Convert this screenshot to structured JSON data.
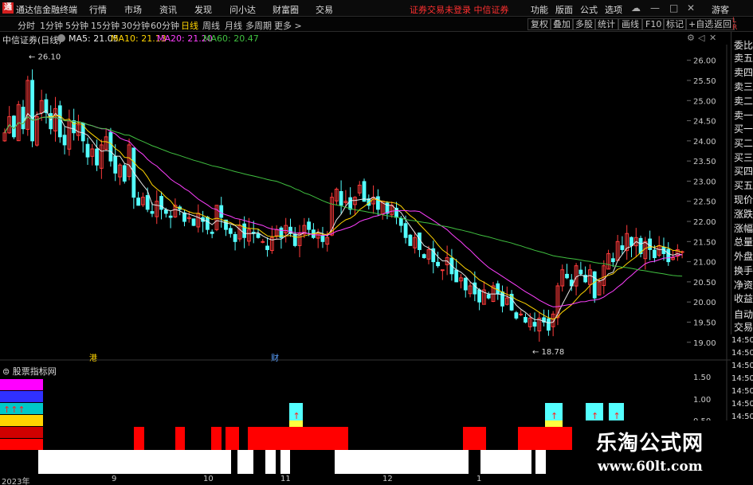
{
  "app": {
    "logo": "通",
    "title": "通达信金融终端",
    "status": "证券交易未登录 中信证券",
    "guest": "游客"
  },
  "menu": [
    "行情",
    "市场",
    "资讯",
    "发现",
    "问小达",
    "财富圈",
    "交易"
  ],
  "right_menu": [
    "功能",
    "版面",
    "公式",
    "选项"
  ],
  "window_controls": [
    "cloud-icon",
    "minimize-icon",
    "maximize-icon",
    "close-icon"
  ],
  "periods": [
    "分时",
    "1分钟",
    "5分钟",
    "15分钟",
    "30分钟",
    "60分钟",
    "日线",
    "周线",
    "月线",
    "多周期",
    "更多 >"
  ],
  "active_period": "日线",
  "tools": [
    "复权",
    "叠加",
    "多股",
    "统计",
    "画线",
    "F10",
    "标记",
    "+自选",
    "返回"
  ],
  "stock": {
    "name": "中信证券(日线)"
  },
  "ma": [
    {
      "label": "MA5: 21.05",
      "color": "#e8e8e8"
    },
    {
      "label": "MA10: 21.13",
      "color": "#ffd400"
    },
    {
      "label": "MA20: 21.20",
      "color": "#ff40ff"
    },
    {
      "label": "MA60: 20.47",
      "color": "#40c040"
    }
  ],
  "side_panel": [
    "委比",
    "卖五",
    "卖四",
    "卖三",
    "卖二",
    "卖一",
    "买一",
    "买二",
    "买三",
    "买四",
    "买五",
    "现价",
    "涨跌",
    "涨幅",
    "总量",
    "外盘",
    "换手",
    "净资",
    "收益",
    "自动",
    "交易"
  ],
  "side_top": "L\nR",
  "side_times": [
    "14:50",
    "14:50",
    "14:50",
    "14:50",
    "14:50",
    "14:50",
    "14:50"
  ],
  "price_axis": [
    "26.00",
    "25.50",
    "25.00",
    "24.50",
    "24.00",
    "23.50",
    "23.00",
    "22.50",
    "22.00",
    "21.50",
    "21.00",
    "20.50",
    "20.00",
    "19.50",
    "19.00"
  ],
  "annotations": {
    "high": "26.10",
    "low": "18.78",
    "marker1": "港",
    "marker2": "财"
  },
  "sub_panel": {
    "title": "股票指标网",
    "axis": [
      "1.50",
      "1.00",
      "0.50"
    ]
  },
  "date_axis": [
    "2023年",
    "9",
    "10",
    "11",
    "12",
    "1"
  ],
  "watermark": {
    "title": "乐淘公式网",
    "url": "www.60lt.com"
  },
  "colors": {
    "up": "#ff3b3b",
    "down": "#54ffff",
    "ma5": "#e8e8e8",
    "ma10": "#ffd400",
    "ma20": "#ff40ff",
    "ma60": "#40c040",
    "red_bar": "#ff0000",
    "white_bar": "#ffffff"
  },
  "chart_data": {
    "type": "candlestick",
    "ylim": [
      18.6,
      26.35
    ],
    "high_label": "26.10",
    "low_label": "18.78",
    "closes": [
      24.2,
      24.6,
      24.1,
      24.9,
      24.3,
      25.5,
      24.0,
      24.6,
      25.0,
      24.7,
      24.3,
      24.8,
      24.1,
      23.9,
      24.5,
      24.2,
      24.4,
      24.0,
      23.6,
      23.8,
      23.4,
      23.9,
      24.1,
      23.5,
      23.2,
      23.4,
      23.0,
      23.9,
      22.6,
      22.4,
      22.6,
      22.3,
      22.2,
      22.5,
      22.3,
      22.2,
      22.1,
      22.4,
      22.3,
      22.0,
      22.1,
      21.9,
      22.2,
      22.0,
      21.8,
      21.7,
      22.4,
      22.1,
      21.8,
      21.7,
      21.5,
      21.9,
      21.6,
      21.8,
      21.7,
      21.6,
      21.5,
      21.3,
      21.6,
      21.8,
      21.6,
      21.9,
      21.7,
      21.4,
      21.7,
      21.9,
      21.8,
      21.6,
      21.7,
      21.5,
      21.6,
      22.6,
      22.8,
      22.4,
      22.5,
      22.3,
      22.6,
      22.9,
      22.5,
      22.4,
      22.6,
      22.3,
      22.5,
      22.2,
      22.4,
      22.1,
      21.9,
      21.6,
      21.4,
      21.6,
      21.3,
      21.1,
      21.3,
      21.0,
      20.9,
      20.8,
      21.1,
      20.7,
      20.5,
      20.6,
      20.3,
      20.4,
      20.2,
      20.0,
      20.3,
      20.1,
      20.4,
      20.2,
      19.9,
      20.1,
      19.8,
      19.6,
      19.7,
      19.5,
      19.6,
      19.4,
      19.6,
      19.5,
      19.3,
      19.7,
      20.4,
      20.8,
      20.6,
      20.4,
      20.9,
      20.7,
      20.5,
      20.8,
      20.1,
      20.5,
      20.9,
      21.2,
      21.0,
      21.5,
      21.3,
      21.7,
      21.4,
      21.6,
      21.2,
      21.5,
      21.3,
      21.1,
      21.4,
      21.2,
      21.0,
      21.1,
      21.3,
      21.25
    ],
    "series": [
      {
        "name": "MA5",
        "values": []
      },
      {
        "name": "MA10",
        "values": []
      },
      {
        "name": "MA20",
        "values": []
      },
      {
        "name": "MA60",
        "values": []
      }
    ]
  },
  "indicator": {
    "legend_rows": [
      {
        "color": "#ff00ff"
      },
      {
        "color": "#3030ff"
      },
      {
        "color": "#00c8c8",
        "glyph": "↑↑↑"
      },
      {
        "color": "#ffd400"
      },
      {
        "color": "#d00000"
      },
      {
        "color": "#ff0000"
      }
    ],
    "red_segments": [
      [
        168,
        181
      ],
      [
        220,
        232
      ],
      [
        265,
        278
      ],
      [
        283,
        300
      ],
      [
        311,
        437
      ],
      [
        581,
        610
      ],
      [
        650,
        718
      ]
    ],
    "white_segments": [
      [
        48,
        290
      ],
      [
        298,
        318
      ],
      [
        333,
        346
      ],
      [
        352,
        364
      ],
      [
        420,
        588
      ],
      [
        603,
        667
      ],
      [
        672,
        685
      ]
    ],
    "cyan_markers": [
      [
        363,
        380
      ],
      [
        684,
        706
      ],
      [
        735,
        757
      ],
      [
        764,
        783
      ]
    ]
  }
}
